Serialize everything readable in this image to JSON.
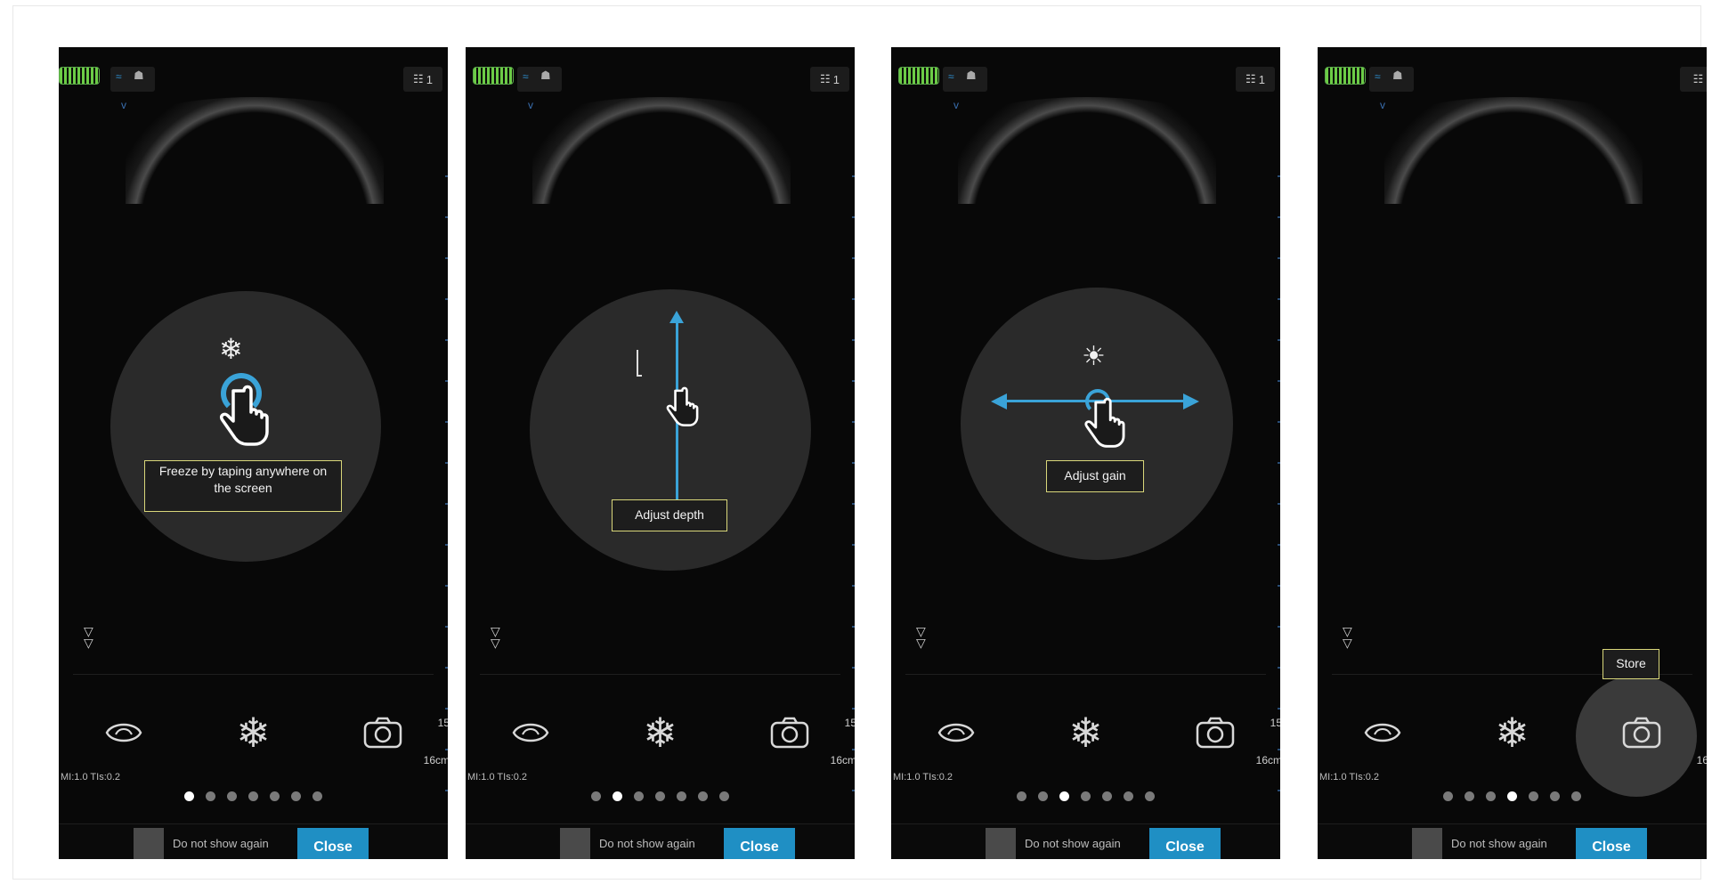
{
  "panels": [
    {
      "patient_count": "1",
      "hint_text": "Freeze by taping anywhere on the screen",
      "scale_top": "15",
      "scale_bottom": "16cm",
      "mi_readout": "MI:1.0  TIs:0.2",
      "active_dot": 0
    },
    {
      "patient_count": "1",
      "hint_text": "Adjust depth",
      "scale_top": "15",
      "scale_bottom": "16cm",
      "mi_readout": "MI:1.0  TIs:0.2",
      "active_dot": 1
    },
    {
      "patient_count": "1",
      "hint_text": "Adjust gain",
      "scale_top": "15",
      "scale_bottom": "16cm",
      "mi_readout": "MI:1.0  TIs:0.2",
      "active_dot": 2
    },
    {
      "patient_count": "",
      "hint_text": "Store",
      "scale_top": "",
      "scale_bottom": "16",
      "mi_readout": "MI:1.0  TIs:0.2",
      "active_dot": 3
    }
  ],
  "footer": {
    "checkbox_label": "Do not show again",
    "close_label": "Close"
  },
  "dot_count": 7,
  "colors": {
    "accent": "#3aa3d8",
    "close_button": "#1f8fc4",
    "label_border": "#d9d77a",
    "battery": "#6ccc46"
  },
  "icons": [
    "battery-icon",
    "wifi-icon",
    "probe-icon",
    "patient-icon",
    "snowflake-icon",
    "touch-hand-icon",
    "depth-ruler-icon",
    "brightness-icon",
    "scan-mode-icon",
    "freeze-icon",
    "camera-icon",
    "double-chevron-down-icon"
  ]
}
